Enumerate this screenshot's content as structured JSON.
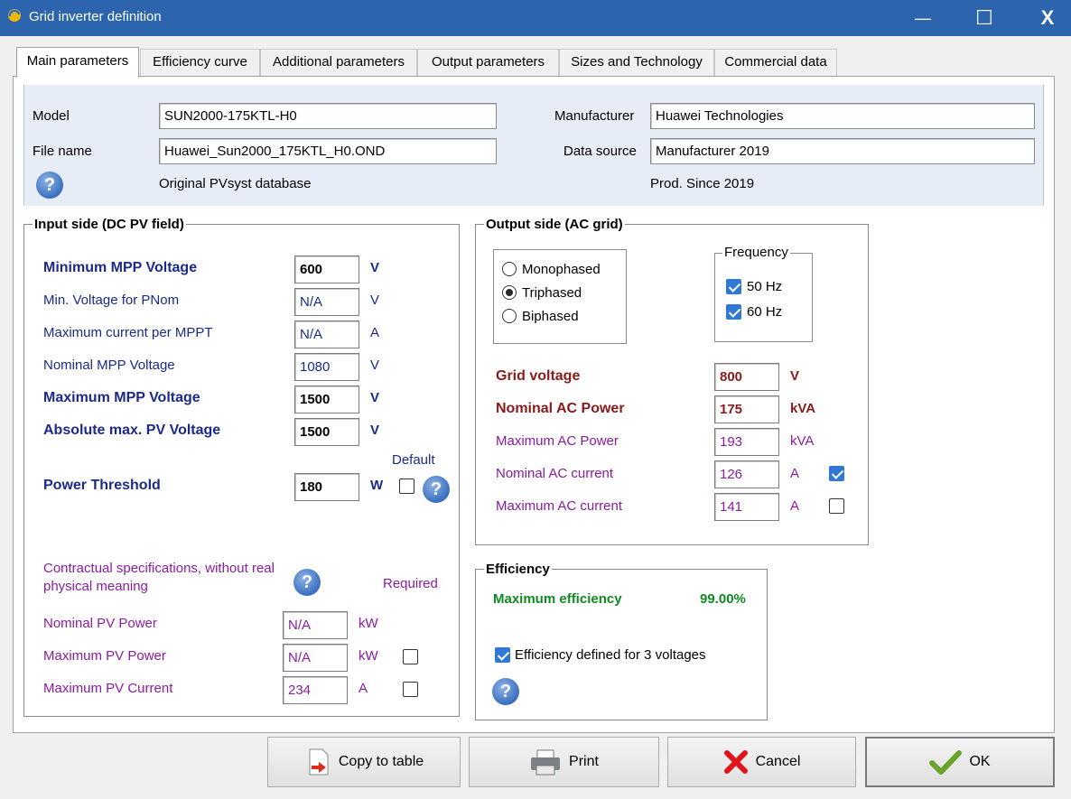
{
  "window": {
    "title": "Grid inverter definition",
    "controls": {
      "minimize": "—",
      "maximize": "☐",
      "close": "X"
    },
    "title_color": "#2c64ad"
  },
  "tabs": [
    {
      "label": "Main parameters",
      "active": true
    },
    {
      "label": "Efficiency curve"
    },
    {
      "label": "Additional parameters"
    },
    {
      "label": "Output parameters"
    },
    {
      "label": "Sizes and Technology"
    },
    {
      "label": "Commercial data"
    }
  ],
  "header": {
    "model_label": "Model",
    "model_value": "SUN2000-175KTL-H0",
    "filename_label": "File name",
    "filename_value": "Huawei_Sun2000_175KTL_H0.OND",
    "manufacturer_label": "Manufacturer",
    "manufacturer_value": "Huawei Technologies",
    "datasource_label": "Data source",
    "datasource_value": "Manufacturer 2019",
    "database_note": "Original PVsyst database",
    "prod_note": "Prod. Since 2019",
    "help": "?"
  },
  "input_side": {
    "title": "Input side (DC PV field)",
    "rows": [
      {
        "label": "Minimum MPP Voltage",
        "value": "600",
        "unit": "V"
      },
      {
        "label": "Min. Voltage for PNom",
        "value": "N/A",
        "unit": "V"
      },
      {
        "label": "Maximum current per MPPT",
        "value": "N/A",
        "unit": "A"
      },
      {
        "label": "Nominal MPP Voltage",
        "value": "1080",
        "unit": "V"
      },
      {
        "label": "Maximum MPP Voltage",
        "value": "1500",
        "unit": "V"
      },
      {
        "label": "Absolute max. PV Voltage",
        "value": "1500",
        "unit": "V"
      }
    ],
    "threshold": {
      "label": "Power Threshold",
      "value": "180",
      "unit": "W",
      "default_label": "Default",
      "default_checked": false
    },
    "contract_note": "Contractual specifications, without real physical meaning",
    "required_label": "Required",
    "contract_rows": [
      {
        "label": "Nominal PV Power",
        "value": "N/A",
        "unit": "kW"
      },
      {
        "label": "Maximum PV Power",
        "value": "N/A",
        "unit": "kW",
        "required": false
      },
      {
        "label": "Maximum PV Current",
        "value": "234",
        "unit": "A",
        "required": false
      }
    ]
  },
  "output_side": {
    "title": "Output side (AC grid)",
    "phases": [
      {
        "label": "Monophased",
        "selected": false
      },
      {
        "label": "Triphased",
        "selected": true
      },
      {
        "label": "Biphased",
        "selected": false
      }
    ],
    "frequency": {
      "title": "Frequency",
      "options": [
        {
          "label": "50 Hz",
          "checked": true
        },
        {
          "label": "60 Hz",
          "checked": true
        }
      ]
    },
    "rows": [
      {
        "label": "Grid voltage",
        "value": "800",
        "unit": "V"
      },
      {
        "label": "Nominal AC Power",
        "value": "175",
        "unit": "kVA"
      },
      {
        "label": "Maximum AC Power",
        "value": "193",
        "unit": "kVA"
      },
      {
        "label": "Nominal AC current",
        "value": "126",
        "unit": "A",
        "checked": true
      },
      {
        "label": "Maximum AC current",
        "value": "141",
        "unit": "A",
        "checked": false
      }
    ]
  },
  "efficiency": {
    "title": "Efficiency",
    "max_label": "Maximum efficiency",
    "max_value": "99.00%",
    "three_voltages_label": "Efficiency defined for 3 voltages",
    "three_voltages_checked": true
  },
  "buttons": {
    "copy": "Copy to table",
    "print": "Print",
    "cancel": "Cancel",
    "ok": "OK"
  }
}
